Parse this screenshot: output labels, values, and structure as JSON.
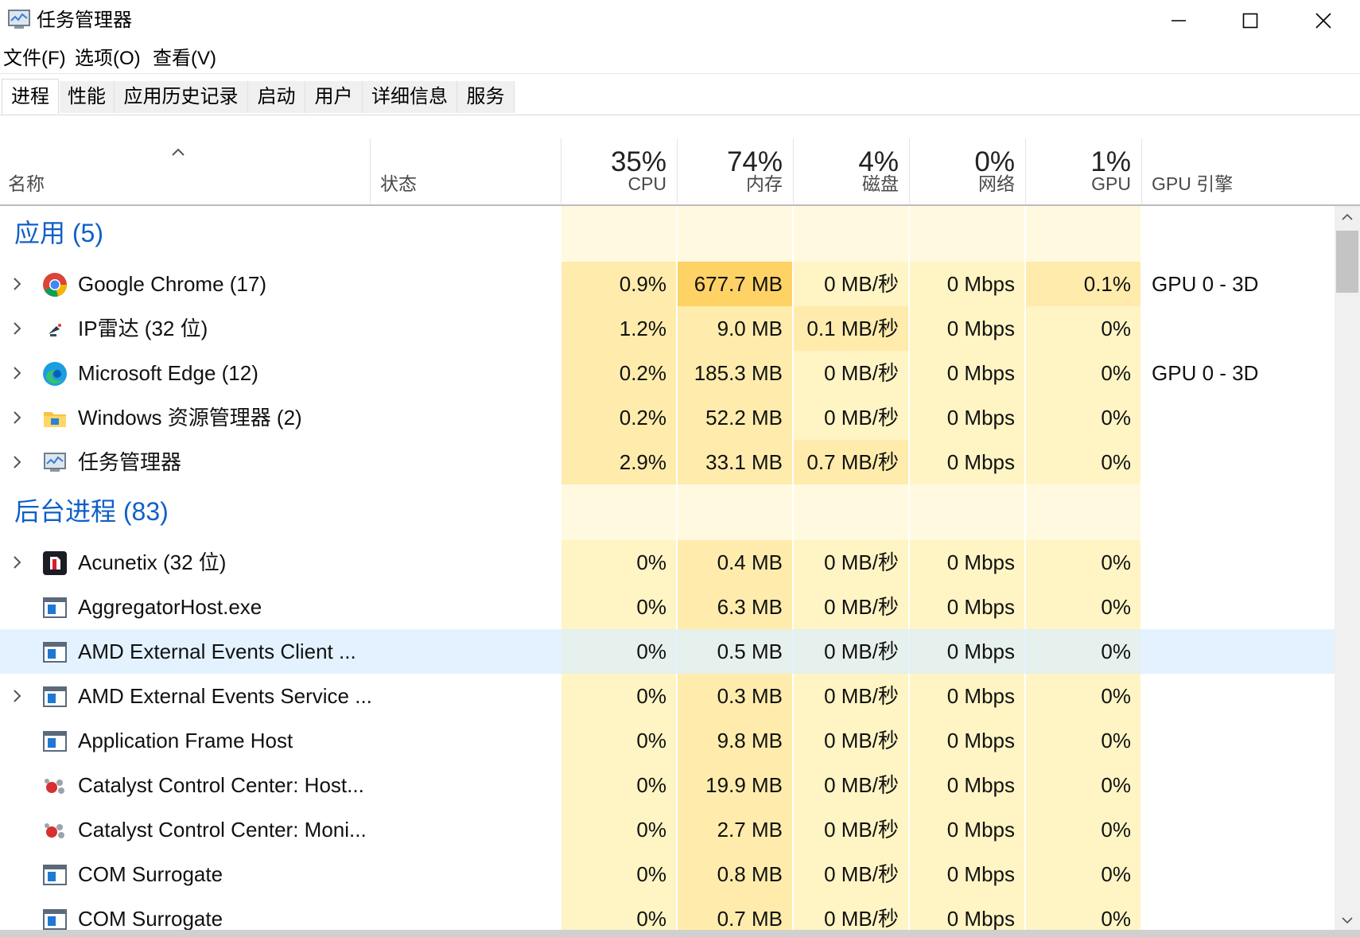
{
  "window": {
    "title": "任务管理器"
  },
  "menu": [
    "文件(F)",
    "选项(O)",
    "查看(V)"
  ],
  "tabs": [
    "进程",
    "性能",
    "应用历史记录",
    "启动",
    "用户",
    "详细信息",
    "服务"
  ],
  "active_tab": "进程",
  "columns": {
    "name": "名称",
    "status": "状态",
    "cpu": {
      "pct": "35%",
      "label": "CPU"
    },
    "memory": {
      "pct": "74%",
      "label": "内存"
    },
    "disk": {
      "pct": "4%",
      "label": "磁盘"
    },
    "network": {
      "pct": "0%",
      "label": "网络"
    },
    "gpu": {
      "pct": "1%",
      "label": "GPU"
    },
    "gpu_engine": "GPU 引擎"
  },
  "groups": {
    "apps": "应用 (5)",
    "background": "后台进程 (83)"
  },
  "apps": [
    {
      "name": "Google Chrome (17)",
      "icon": "chrome-icon",
      "expandable": true,
      "cpu": "0.9%",
      "mem": "677.7 MB",
      "disk": "0 MB/秒",
      "net": "0 Mbps",
      "gpu": "0.1%",
      "engine": "GPU 0 - 3D"
    },
    {
      "name": "IP雷达 (32 位)",
      "icon": "radar-icon",
      "expandable": true,
      "cpu": "1.2%",
      "mem": "9.0 MB",
      "disk": "0.1 MB/秒",
      "net": "0 Mbps",
      "gpu": "0%",
      "engine": ""
    },
    {
      "name": "Microsoft Edge (12)",
      "icon": "edge-icon",
      "expandable": true,
      "cpu": "0.2%",
      "mem": "185.3 MB",
      "disk": "0 MB/秒",
      "net": "0 Mbps",
      "gpu": "0%",
      "engine": "GPU 0 - 3D"
    },
    {
      "name": "Windows 资源管理器 (2)",
      "icon": "folder-icon",
      "expandable": true,
      "cpu": "0.2%",
      "mem": "52.2 MB",
      "disk": "0 MB/秒",
      "net": "0 Mbps",
      "gpu": "0%",
      "engine": ""
    },
    {
      "name": "任务管理器",
      "icon": "task-manager-icon",
      "expandable": true,
      "cpu": "2.9%",
      "mem": "33.1 MB",
      "disk": "0.7 MB/秒",
      "net": "0 Mbps",
      "gpu": "0%",
      "engine": ""
    }
  ],
  "background": [
    {
      "name": "Acunetix (32 位)",
      "icon": "acunetix-icon",
      "expandable": true,
      "cpu": "0%",
      "mem": "0.4 MB",
      "disk": "0 MB/秒",
      "net": "0 Mbps",
      "gpu": "0%",
      "engine": ""
    },
    {
      "name": "AggregatorHost.exe",
      "icon": "window-app-icon",
      "expandable": false,
      "cpu": "0%",
      "mem": "6.3 MB",
      "disk": "0 MB/秒",
      "net": "0 Mbps",
      "gpu": "0%",
      "engine": ""
    },
    {
      "name": "AMD External Events Client ...",
      "icon": "window-app-icon",
      "expandable": false,
      "cpu": "0%",
      "mem": "0.5 MB",
      "disk": "0 MB/秒",
      "net": "0 Mbps",
      "gpu": "0%",
      "engine": "",
      "selected": true
    },
    {
      "name": "AMD External Events Service ...",
      "icon": "window-app-icon",
      "expandable": true,
      "cpu": "0%",
      "mem": "0.3 MB",
      "disk": "0 MB/秒",
      "net": "0 Mbps",
      "gpu": "0%",
      "engine": ""
    },
    {
      "name": "Application Frame Host",
      "icon": "window-app-icon",
      "expandable": false,
      "cpu": "0%",
      "mem": "9.8 MB",
      "disk": "0 MB/秒",
      "net": "0 Mbps",
      "gpu": "0%",
      "engine": ""
    },
    {
      "name": "Catalyst Control Center: Host...",
      "icon": "catalyst-icon",
      "expandable": false,
      "cpu": "0%",
      "mem": "19.9 MB",
      "disk": "0 MB/秒",
      "net": "0 Mbps",
      "gpu": "0%",
      "engine": ""
    },
    {
      "name": "Catalyst Control Center: Moni...",
      "icon": "catalyst-icon",
      "expandable": false,
      "cpu": "0%",
      "mem": "2.7 MB",
      "disk": "0 MB/秒",
      "net": "0 Mbps",
      "gpu": "0%",
      "engine": ""
    },
    {
      "name": "COM Surrogate",
      "icon": "window-app-icon",
      "expandable": false,
      "cpu": "0%",
      "mem": "0.8 MB",
      "disk": "0 MB/秒",
      "net": "0 Mbps",
      "gpu": "0%",
      "engine": ""
    },
    {
      "name": "COM Surrogate",
      "icon": "window-app-icon",
      "expandable": false,
      "cpu": "0%",
      "mem": "0.7 MB",
      "disk": "0 MB/秒",
      "net": "0 Mbps",
      "gpu": "0%",
      "engine": ""
    }
  ],
  "colors": {
    "heat_light": "#fff4c4",
    "heat_mid": "#ffecac",
    "heat_high": "#ffd266",
    "group_title": "#1060c8",
    "selected": "#cde8ff"
  }
}
